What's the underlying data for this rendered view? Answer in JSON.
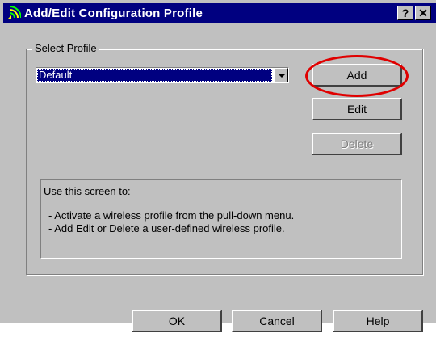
{
  "window": {
    "title": "Add/Edit Configuration Profile",
    "help_button": "?",
    "close_button": "✕"
  },
  "profile_group": {
    "label": "Select Profile",
    "selected_profile": "Default"
  },
  "side_buttons": {
    "add": "Add",
    "edit": "Edit",
    "delete": "Delete"
  },
  "info": {
    "heading": "Use this screen to:",
    "lines": [
      "- Activate a wireless profile from the pull-down menu.",
      "- Add Edit or Delete a user-defined wireless profile."
    ]
  },
  "footer_buttons": {
    "ok": "OK",
    "cancel": "Cancel",
    "help": "Help"
  },
  "colors": {
    "titlebar": "#000080",
    "face": "#c0c0c0",
    "annotation": "#e00000"
  }
}
